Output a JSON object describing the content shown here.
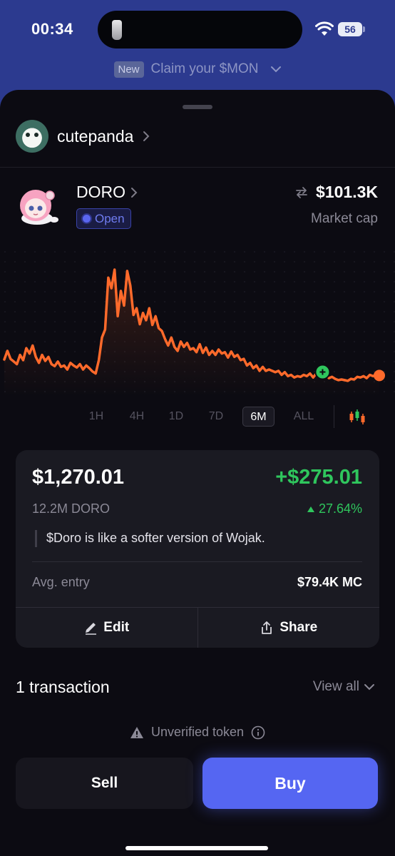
{
  "status_bar": {
    "time": "00:34",
    "battery": "56"
  },
  "promo": {
    "badge": "New",
    "text": "Claim your $MON"
  },
  "owner": {
    "name": "cutepanda"
  },
  "token": {
    "name": "DORO",
    "status": "Open",
    "market_cap_value": "$101.3K",
    "market_cap_label": "Market cap"
  },
  "chart": {
    "ranges": [
      "1H",
      "4H",
      "1D",
      "7D",
      "6M",
      "ALL"
    ],
    "selected_range": "6M",
    "line_color": "#ff6a2b",
    "marker_color": "#2fc65d"
  },
  "chart_data": {
    "type": "line",
    "series": [
      {
        "values": [
          45,
          58,
          46,
          42,
          38,
          52,
          44,
          62,
          54,
          66,
          49,
          40,
          52,
          43,
          49,
          38,
          35,
          42,
          34,
          36,
          30,
          40,
          36,
          33,
          38,
          30,
          36,
          32,
          27,
          24,
          44,
          78,
          90,
          168,
          152,
          180,
          110,
          148,
          126,
          178,
          156,
          112,
          122,
          98,
          115,
          104,
          122,
          97,
          110,
          92,
          88,
          76,
          66,
          78,
          64,
          58,
          72,
          64,
          70,
          60,
          62,
          56,
          68,
          55,
          63,
          52,
          58,
          52,
          60,
          54,
          56,
          48,
          57,
          49,
          52,
          44,
          46,
          36,
          40,
          32,
          36,
          28,
          34,
          28,
          30,
          28,
          26,
          28,
          22,
          26,
          20,
          22,
          18,
          20,
          19,
          22,
          20,
          24,
          18,
          24,
          20,
          22,
          22,
          17,
          19,
          16,
          14,
          15,
          14,
          13,
          16,
          15,
          19,
          18,
          20,
          17,
          22,
          20,
          22,
          21
        ]
      }
    ]
  },
  "position": {
    "value": "$1,270.01",
    "pnl": "+$275.01",
    "amount": "12.2M DORO",
    "pnl_pct": "27.64%",
    "description": "$Doro is like a softer version of Wojak.",
    "entry_label": "Avg. entry",
    "entry_value": "$79.4K MC",
    "edit_label": "Edit",
    "share_label": "Share"
  },
  "transactions": {
    "count_label": "1 transaction",
    "view_all_label": "View all"
  },
  "warning": {
    "text": "Unverified token"
  },
  "actions": {
    "sell_label": "Sell",
    "buy_label": "Buy"
  },
  "colors": {
    "accent": "#5566f2",
    "positive": "#2fc65d",
    "chart_line": "#ff6a2b"
  }
}
